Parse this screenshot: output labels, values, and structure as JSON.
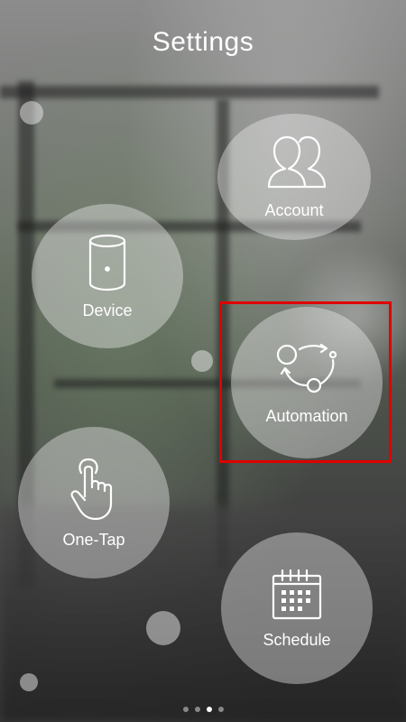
{
  "page": {
    "title": "Settings"
  },
  "menu": {
    "account": {
      "label": "Account",
      "icon": "users-icon"
    },
    "device": {
      "label": "Device",
      "icon": "device-cylinder-icon"
    },
    "automation": {
      "label": "Automation",
      "icon": "automation-cycle-icon"
    },
    "one_tap": {
      "label": "One-Tap",
      "icon": "tap-hand-icon"
    },
    "schedule": {
      "label": "Schedule",
      "icon": "calendar-icon"
    }
  },
  "highlight": {
    "target": "automation",
    "color": "#e00000"
  },
  "pager": {
    "count": 4,
    "active_index": 2
  }
}
